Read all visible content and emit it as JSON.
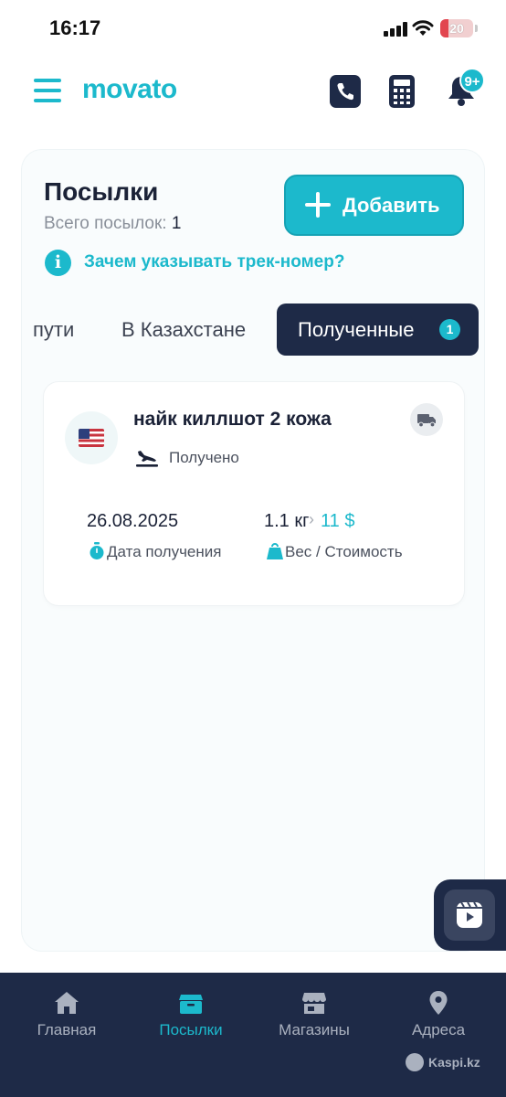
{
  "status_bar": {
    "time": "16:17",
    "battery": "20"
  },
  "header": {
    "logo": "movato",
    "notification_badge": "9+"
  },
  "parcels": {
    "title": "Посылки",
    "total_label": "Всего посылок:",
    "total_count": "1",
    "add_label": "Добавить",
    "info_link": "Зачем указывать трек-номер?"
  },
  "tabs": [
    {
      "label": "пути",
      "active": false
    },
    {
      "label": "В Казахстане",
      "active": false
    },
    {
      "label": "Полученные",
      "active": true,
      "badge": "1"
    }
  ],
  "parcel": {
    "name": "найк киллшот 2 кожа",
    "status": "Получено",
    "date": "26.08.2025",
    "date_label": "Дата получения",
    "weight": "1.1 кг",
    "cost": "11 $",
    "weight_cost_label": "Вес / Стоимость",
    "flag_icon": "us-flag-icon"
  },
  "bottom_nav": [
    {
      "label": "Главная",
      "icon": "home-icon",
      "active": false
    },
    {
      "label": "Посылки",
      "icon": "box-icon",
      "active": true
    },
    {
      "label": "Магазины",
      "icon": "store-icon",
      "active": false
    },
    {
      "label": "Адреса",
      "icon": "location-pin-icon",
      "active": false
    }
  ],
  "watermark": "Kaspi.kz",
  "colors": {
    "accent": "#1cb9cc",
    "navy": "#1e2a47"
  }
}
